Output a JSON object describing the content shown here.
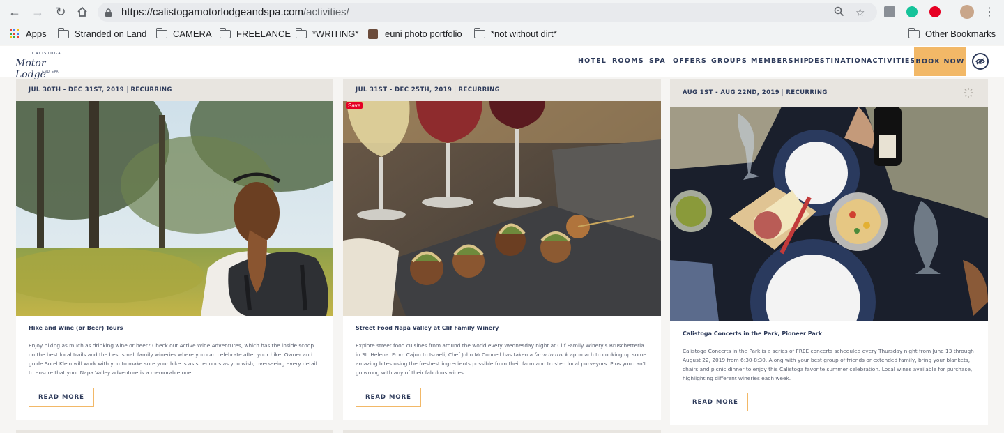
{
  "browser": {
    "url_host": "https://calistogamotorlodgeandspa.com",
    "url_path": "/activities/",
    "bookmarks": [
      {
        "label": "Apps",
        "icon": "apps-grid-icon"
      },
      {
        "label": "Stranded on Land",
        "icon": "folder-icon"
      },
      {
        "label": "CAMERA",
        "icon": "folder-icon"
      },
      {
        "label": "FREELANCE",
        "icon": "folder-icon"
      },
      {
        "label": "*WRITING*",
        "icon": "folder-icon"
      },
      {
        "label": "euni photo portfolio",
        "icon": "favicon-icon"
      },
      {
        "label": "*not without dirt*",
        "icon": "folder-icon"
      }
    ],
    "other_bookmarks": "Other Bookmarks"
  },
  "site": {
    "logo": {
      "top": "CALISTOGA",
      "main": "Motor Lodge",
      "bottom": "AND SPA"
    },
    "nav": [
      "HOTEL",
      "ROOMS",
      "SPA",
      "OFFERS",
      "GROUPS",
      "MEMBERSHIP",
      "DESTINATION",
      "ACTIVITIES"
    ],
    "book_now": "BOOK NOW",
    "accent_color": "#f2b867",
    "navy_color": "#2d3a5a"
  },
  "cards": [
    {
      "date": "JUL 30TH - DEC 31ST, 2019",
      "tag": "RECURRING",
      "title": "Hike and Wine (or Beer) Tours",
      "description": "Enjoy hiking as much as drinking wine or beer? Check out Active Wine Adventures, which has the inside scoop on the best local trails and the best small family wineries where you can celebrate after your hike. Owner and guide Sorel Klein will work with you to make sure your hike is as strenuous as you wish, overseeing every detail to ensure that your Napa Valley adventure is a memorable one.",
      "button": "READ MORE"
    },
    {
      "date": "JUL 31ST - DEC 25TH, 2019",
      "tag": "RECURRING",
      "title": "Street Food Napa Valley at Clif Family Winery",
      "description_before": "Explore street food cuisines from around the world every Wednesday night at Clif Family Winery's Bruschetteria in St. Helena. From Cajun to Israeli, Chef John McConnell has taken a ",
      "description_em": "farm to truck",
      "description_after": " approach to cooking up some amazing bites using the freshest ingredients possible from their farm and trusted local purveyors. Plus you can't go wrong with any of their fabulous wines.",
      "button": "READ MORE",
      "save_badge": "Save"
    },
    {
      "date": "AUG 1ST - AUG 22ND, 2019",
      "tag": "RECURRING",
      "title": "Calistoga Concerts in the Park, Pioneer Park",
      "description": "Calistoga Concerts in the Park is a series of FREE concerts scheduled every Thursday night from June 13 through August 22, 2019 from 6:30-8:30. Along with your best group of friends or extended family, bring your blankets, chairs and picnic dinner to enjoy this Calistoga favorite summer celebration. Local wines available for purchase, highlighting different wineries each week.",
      "button": "READ MORE"
    }
  ]
}
